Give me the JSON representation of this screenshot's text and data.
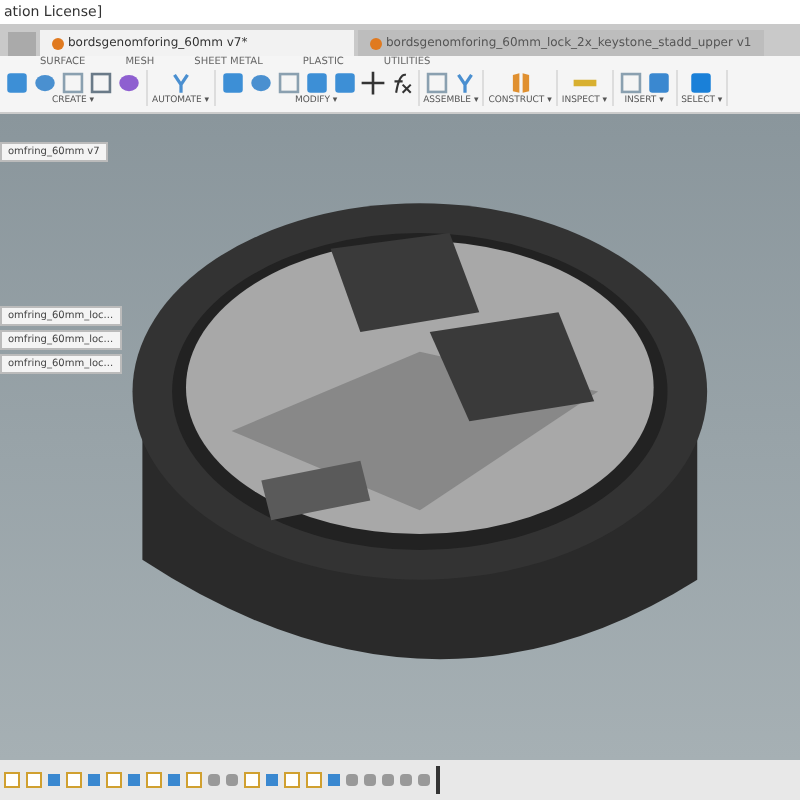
{
  "window": {
    "title": "ation License]"
  },
  "document_tabs": [
    {
      "label": "bordsgenomforing_60mm v7*",
      "selected": true
    },
    {
      "label": "bordsgenomforing_60mm_lock_2x_keystone_stadd_upper v1",
      "selected": false
    }
  ],
  "toolbar_tabs": [
    {
      "label": "SURFACE",
      "selected": false
    },
    {
      "label": "MESH",
      "selected": false
    },
    {
      "label": "SHEET METAL",
      "selected": false
    },
    {
      "label": "PLASTIC",
      "selected": false
    },
    {
      "label": "UTILITIES",
      "selected": false
    }
  ],
  "tool_groups": [
    {
      "label": "CREATE ▾",
      "icons": [
        {
          "kind": "block"
        },
        {
          "kind": "curve"
        },
        {
          "kind": "frame"
        },
        {
          "kind": "sketch"
        },
        {
          "kind": "form"
        }
      ]
    },
    {
      "label": "AUTOMATE ▾",
      "icons": [
        {
          "kind": "node"
        }
      ]
    },
    {
      "label": "MODIFY ▾",
      "icons": [
        {
          "kind": "block"
        },
        {
          "kind": "curve"
        },
        {
          "kind": "frame"
        },
        {
          "kind": "block"
        },
        {
          "kind": "block"
        },
        {
          "kind": "move"
        },
        {
          "kind": "fx"
        }
      ]
    },
    {
      "label": "ASSEMBLE ▾",
      "icons": [
        {
          "kind": "frame"
        },
        {
          "kind": "node"
        }
      ]
    },
    {
      "label": "CONSTRUCT ▾",
      "icons": [
        {
          "kind": "plane"
        }
      ]
    },
    {
      "label": "INSPECT ▾",
      "icons": [
        {
          "kind": "ruler"
        }
      ]
    },
    {
      "label": "INSERT ▾",
      "icons": [
        {
          "kind": "frame"
        },
        {
          "kind": "image"
        }
      ]
    },
    {
      "label": "SELECT ▾",
      "icons": [
        {
          "kind": "cursor"
        }
      ]
    }
  ],
  "browser": {
    "items": [
      "omfring_60mm v7"
    ]
  },
  "components": [
    "omfring_60mm_loc...",
    "omfring_60mm_loc...",
    "omfring_60mm_loc..."
  ],
  "timeline": {
    "steps": [
      {
        "kind": "sketch"
      },
      {
        "kind": "sketch"
      },
      {
        "kind": "feature"
      },
      {
        "kind": "sketch"
      },
      {
        "kind": "feature"
      },
      {
        "kind": "sketch"
      },
      {
        "kind": "feature"
      },
      {
        "kind": "sketch"
      },
      {
        "kind": "feature"
      },
      {
        "kind": "sketch"
      },
      {
        "kind": "body"
      },
      {
        "kind": "body"
      },
      {
        "kind": "sketch"
      },
      {
        "kind": "feature"
      },
      {
        "kind": "sketch"
      },
      {
        "kind": "sketch"
      },
      {
        "kind": "feature"
      },
      {
        "kind": "body"
      },
      {
        "kind": "body"
      },
      {
        "kind": "body"
      },
      {
        "kind": "body"
      },
      {
        "kind": "body"
      }
    ]
  }
}
